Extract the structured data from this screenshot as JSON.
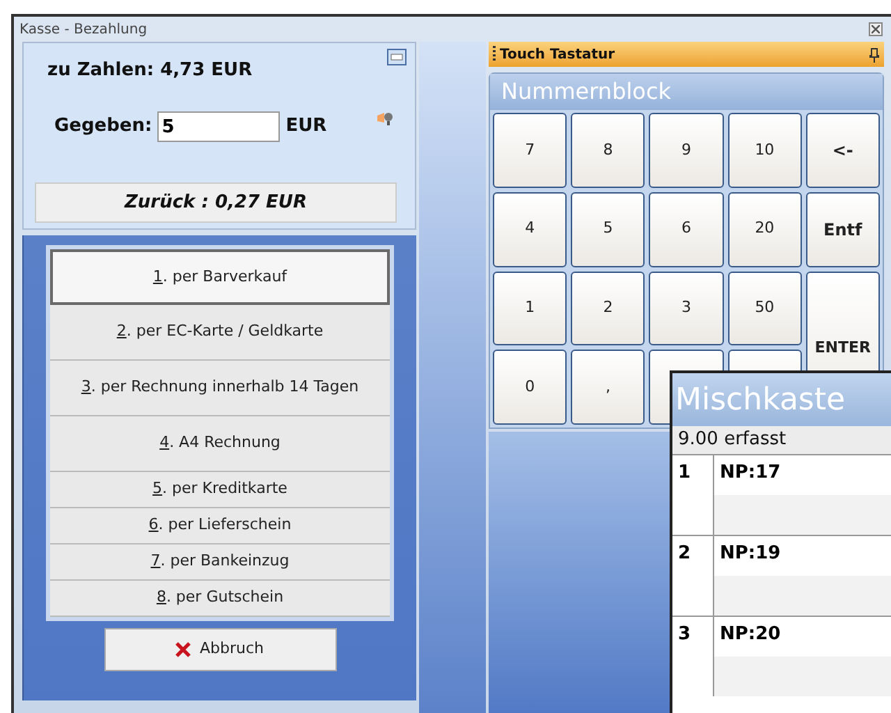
{
  "window": {
    "title": "Kasse - Bezahlung"
  },
  "payment": {
    "due_label": "zu Zahlen:",
    "due_value": "4,73 EUR",
    "given_label": "Gegeben:",
    "given_value": "5",
    "given_unit": "EUR",
    "change": "Zurück : 0,27 EUR"
  },
  "options": [
    {
      "hotkey": "1",
      "label": ". per Barverkauf",
      "selected": true
    },
    {
      "hotkey": "2",
      "label": ". per EC-Karte / Geldkarte",
      "selected": false
    },
    {
      "hotkey": "3",
      "label": ". per Rechnung innerhalb 14 Tagen",
      "selected": false
    },
    {
      "hotkey": "4",
      "label": ". A4 Rechnung",
      "selected": false
    },
    {
      "hotkey": "5",
      "label": ". per Kreditkarte",
      "selected": false
    },
    {
      "hotkey": "6",
      "label": ". per Lieferschein",
      "selected": false
    },
    {
      "hotkey": "7",
      "label": ". per Bankeinzug",
      "selected": false
    },
    {
      "hotkey": "8",
      "label": ". per Gutschein",
      "selected": false
    }
  ],
  "cancel_button": "Abbruch",
  "keyboard": {
    "title": "Touch Tastatur",
    "section": "Nummernblock",
    "keys": [
      {
        "label": "7",
        "kind": "key"
      },
      {
        "label": "8",
        "kind": "key"
      },
      {
        "label": "9",
        "kind": "key"
      },
      {
        "label": "10",
        "kind": "key"
      },
      {
        "label": "<-",
        "kind": "bold"
      },
      {
        "label": "4",
        "kind": "key"
      },
      {
        "label": "5",
        "kind": "key"
      },
      {
        "label": "6",
        "kind": "key"
      },
      {
        "label": "20",
        "kind": "key"
      },
      {
        "label": "Entf",
        "kind": "bold"
      },
      {
        "label": "1",
        "kind": "key"
      },
      {
        "label": "2",
        "kind": "key"
      },
      {
        "label": "3",
        "kind": "key"
      },
      {
        "label": "50",
        "kind": "key"
      },
      {
        "label": "ENTER",
        "kind": "enter"
      },
      {
        "label": "0",
        "kind": "key"
      },
      {
        "label": ",",
        "kind": "key"
      },
      {
        "kind": "blank"
      },
      {
        "kind": "blank"
      }
    ]
  },
  "mix_window": {
    "title": "Mischkaste",
    "status": "9.00 erfasst",
    "rows": [
      {
        "number": "1",
        "label": "NP:17"
      },
      {
        "number": "2",
        "label": "NP:19"
      },
      {
        "number": "3",
        "label": "NP:20"
      }
    ]
  }
}
